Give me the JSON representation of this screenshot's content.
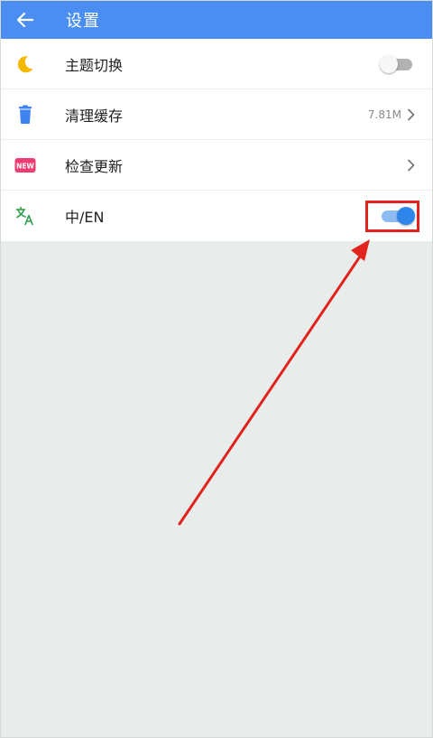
{
  "header": {
    "title": "设置"
  },
  "settings": {
    "items": [
      {
        "label": "主题切换",
        "icon": "moon-icon",
        "control": "switch",
        "on": false
      },
      {
        "label": "清理缓存",
        "icon": "trash-icon",
        "value": "7.81M",
        "control": "chevron"
      },
      {
        "label": "检查更新",
        "icon": "new-badge-icon",
        "badge": "NEW",
        "control": "chevron"
      },
      {
        "label": "中/EN",
        "icon": "translate-icon",
        "control": "switch",
        "on": true
      }
    ]
  },
  "colors": {
    "appbar": "#4a8ef2",
    "background": "#e8edec",
    "switch_on": "#2f86ea",
    "annotation": "#e0231d"
  }
}
